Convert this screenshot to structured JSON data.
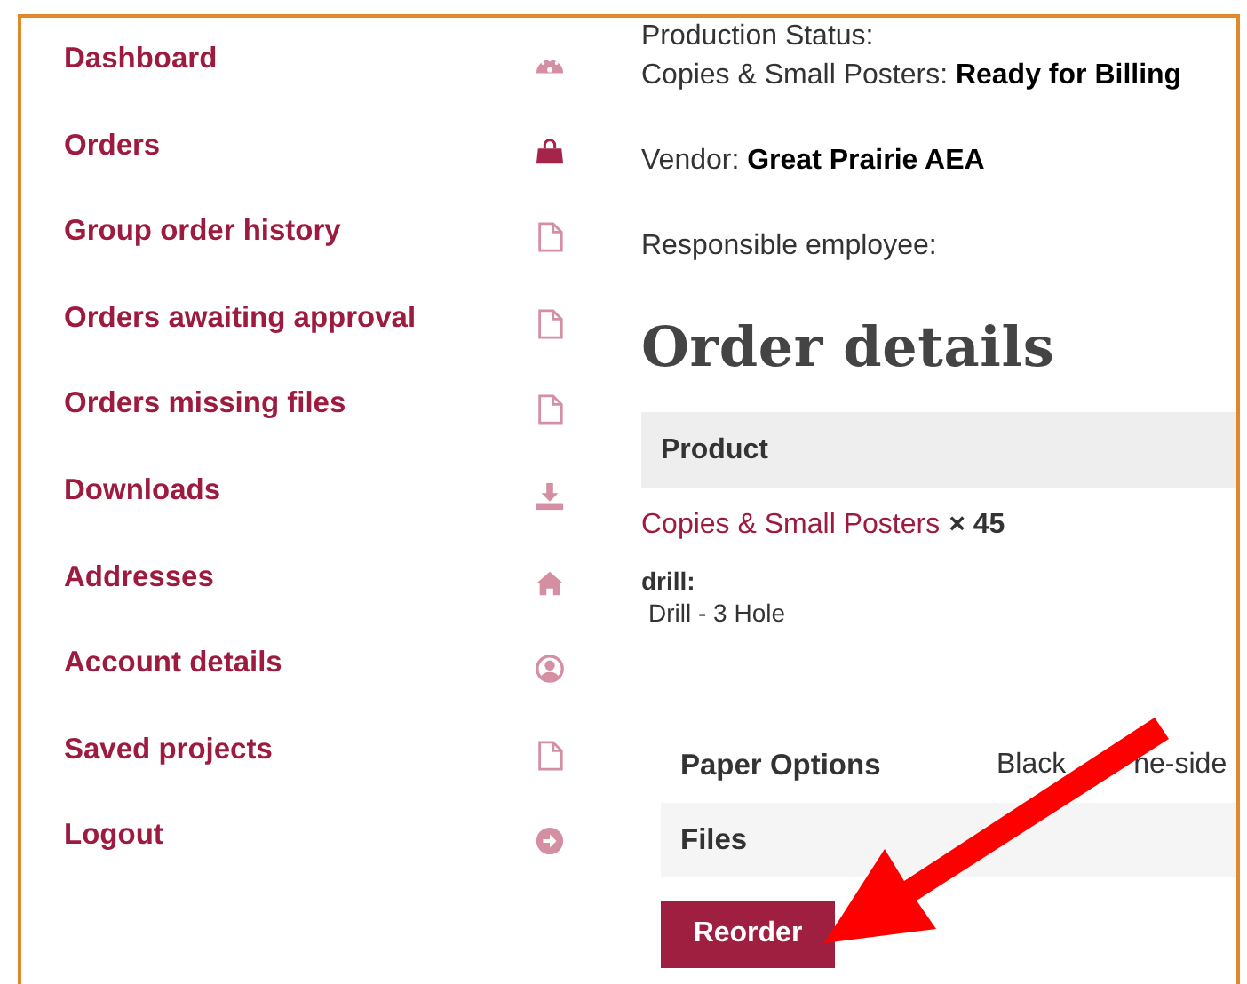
{
  "sidebar": {
    "items": [
      {
        "label": "Dashboard",
        "selected": false
      },
      {
        "label": "Orders",
        "selected": true
      },
      {
        "label": "Group order history",
        "selected": false
      },
      {
        "label": "Orders awaiting approval",
        "selected": false
      },
      {
        "label": "Orders missing files",
        "selected": false
      },
      {
        "label": "Downloads",
        "selected": false
      },
      {
        "label": "Addresses",
        "selected": false
      },
      {
        "label": "Account details",
        "selected": false
      },
      {
        "label": "Saved projects",
        "selected": false
      },
      {
        "label": "Logout",
        "selected": false
      }
    ]
  },
  "order": {
    "production_status_label": "Production Status:",
    "production_status": "Copies & Small Posters: **Ready for Billing**",
    "vendor": "Vendor: **Great Prairie AEA**",
    "responsible_employee": "Responsible employee:"
  },
  "order_details": {
    "title": "Order details",
    "column_header": "Product",
    "product": {
      "name": "Copies & Small Posters",
      "quantity": "× 45"
    },
    "meta": {
      "label": "drill:",
      "value": "Drill - 3 Hole"
    },
    "rows": [
      {
        "label": "Paper Options",
        "value_parts": [
          "Black",
          "ne-side"
        ]
      },
      {
        "label": "Files"
      }
    ],
    "button": "Reorder"
  },
  "annotation": {
    "kind": "arrow"
  }
}
